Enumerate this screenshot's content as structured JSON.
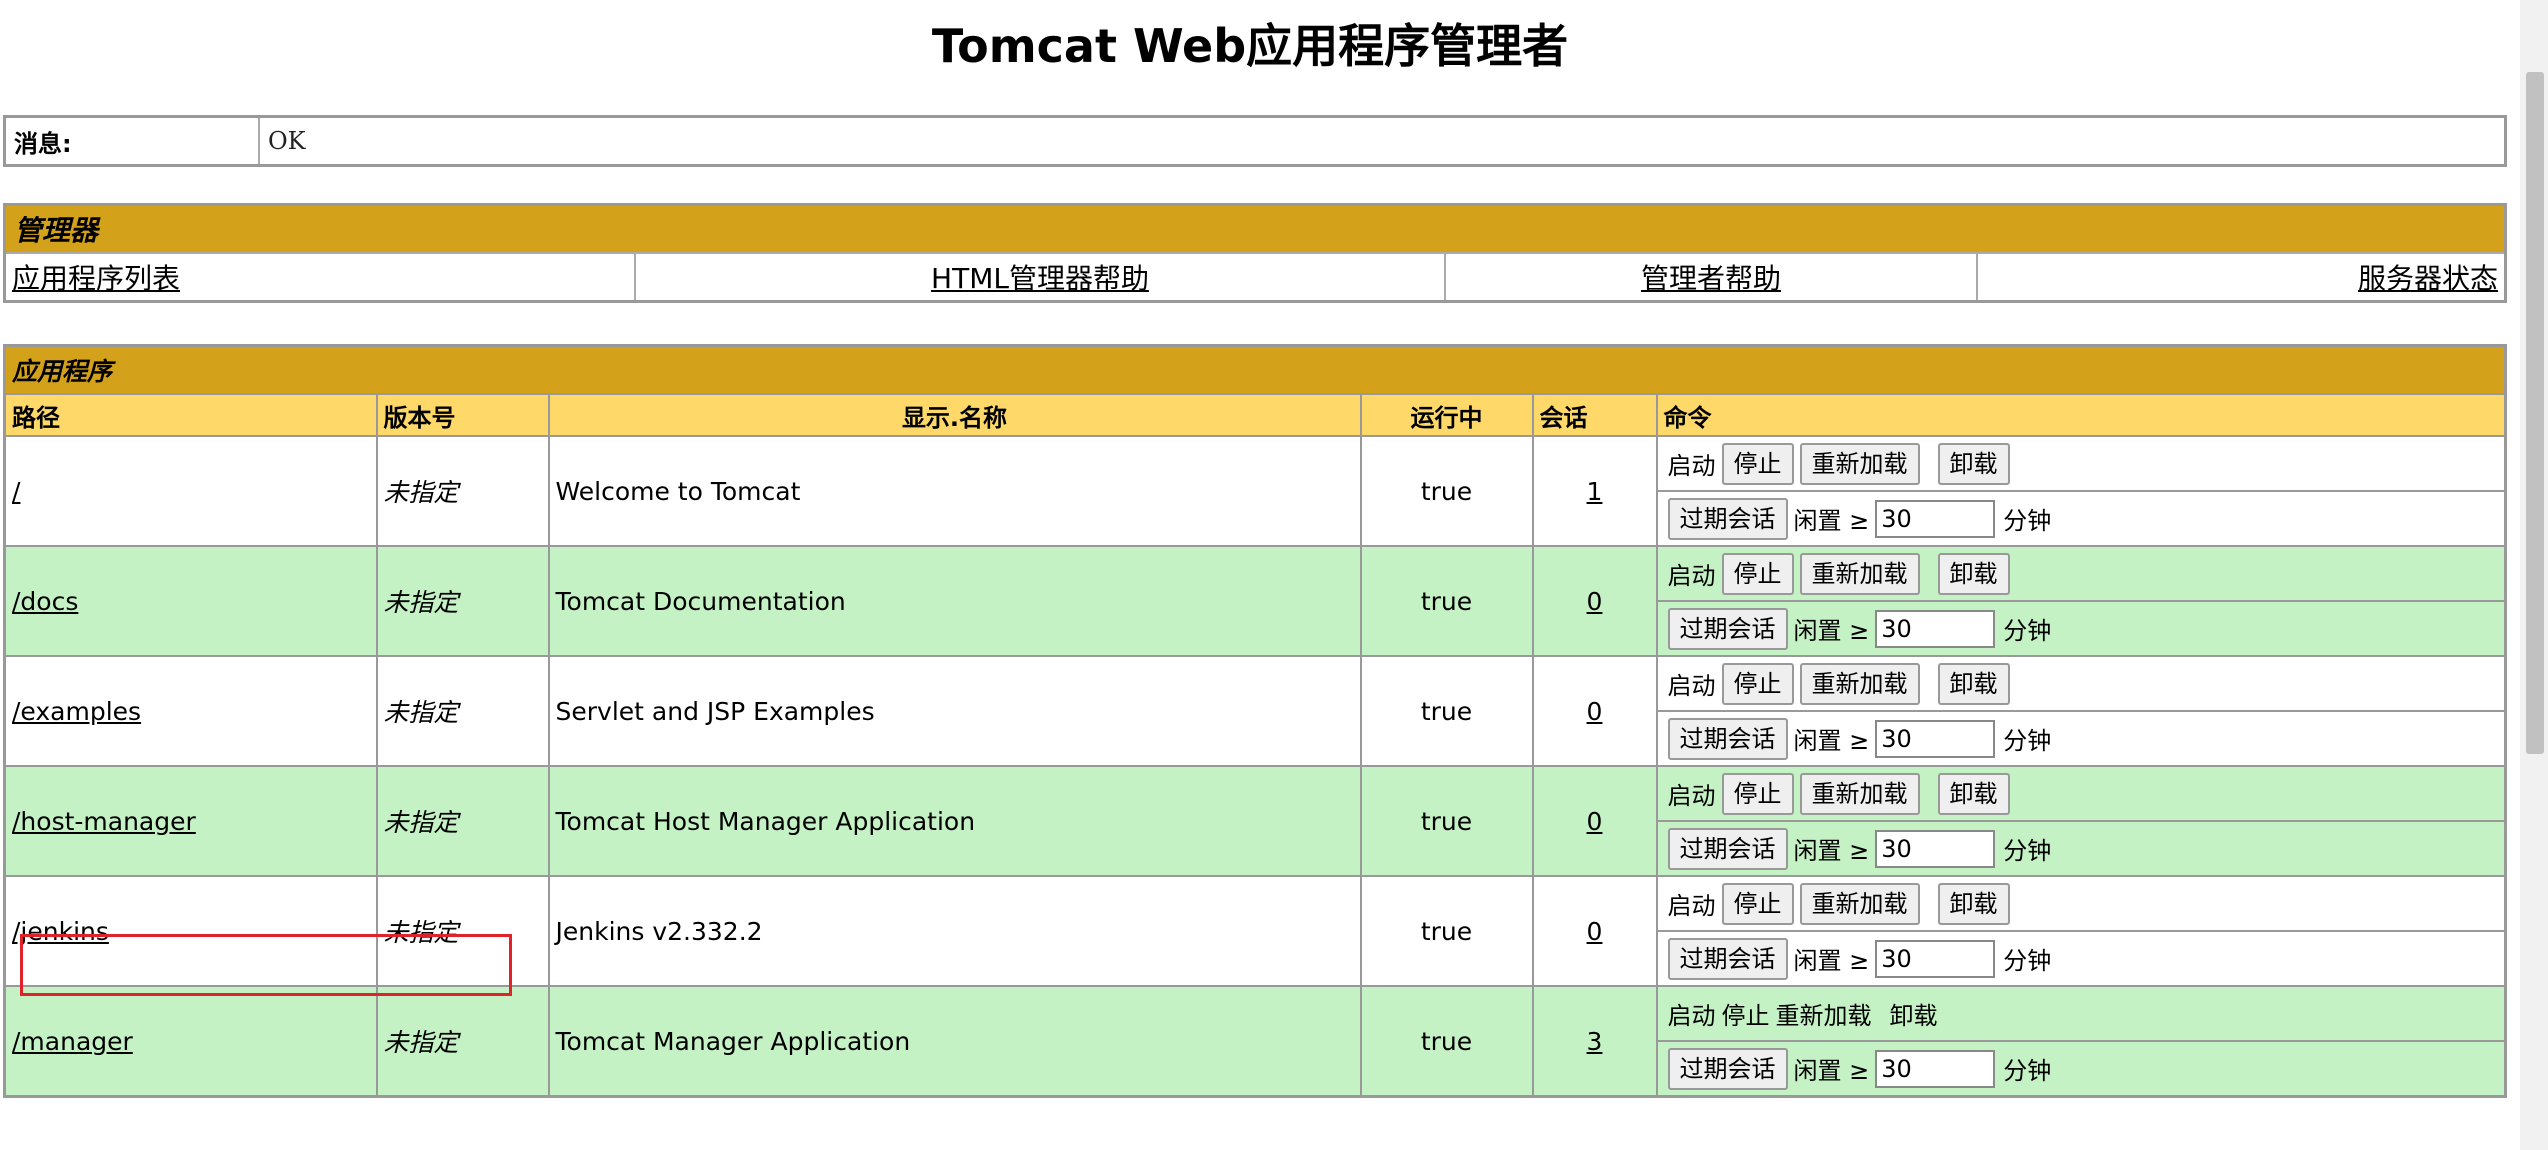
{
  "title": "Tomcat Web应用程序管理者",
  "message": {
    "label": "消息:",
    "text": "OK"
  },
  "manager": {
    "heading": "管理器",
    "links": [
      "应用程序列表",
      "HTML管理器帮助",
      "管理者帮助",
      "服务器状态"
    ]
  },
  "apps": {
    "heading": "应用程序",
    "columns": [
      "路径",
      "版本号",
      "显示.名称",
      "运行中",
      "会话",
      "命令"
    ],
    "commands": {
      "start": "启动",
      "stop": "停止",
      "reload": "重新加载",
      "undeploy": "卸载",
      "expire": "过期会话",
      "idle": "闲置 ≥",
      "minutes": "分钟"
    },
    "rows": [
      {
        "path": "/",
        "version": "未指定",
        "display": "Welcome to Tomcat",
        "running": "true",
        "sessions": "1",
        "idle_value": "30"
      },
      {
        "path": "/docs",
        "version": "未指定",
        "display": "Tomcat Documentation",
        "running": "true",
        "sessions": "0",
        "idle_value": "30"
      },
      {
        "path": "/examples",
        "version": "未指定",
        "display": "Servlet and JSP Examples",
        "running": "true",
        "sessions": "0",
        "idle_value": "30"
      },
      {
        "path": "/host-manager",
        "version": "未指定",
        "display": "Tomcat Host Manager Application",
        "running": "true",
        "sessions": "0",
        "idle_value": "30"
      },
      {
        "path": "/jenkins",
        "version": "未指定",
        "display": "Jenkins v2.332.2",
        "running": "true",
        "sessions": "0",
        "idle_value": "30"
      },
      {
        "path": "/manager",
        "version": "未指定",
        "display": "Tomcat Manager Application",
        "running": "true",
        "sessions": "3",
        "idle_value": "30"
      }
    ]
  },
  "colors": {
    "section_header": "#d4a21a",
    "column_header": "#fed96a",
    "row_alt": "#c4f2c4",
    "highlight_box": "#e0232a"
  }
}
